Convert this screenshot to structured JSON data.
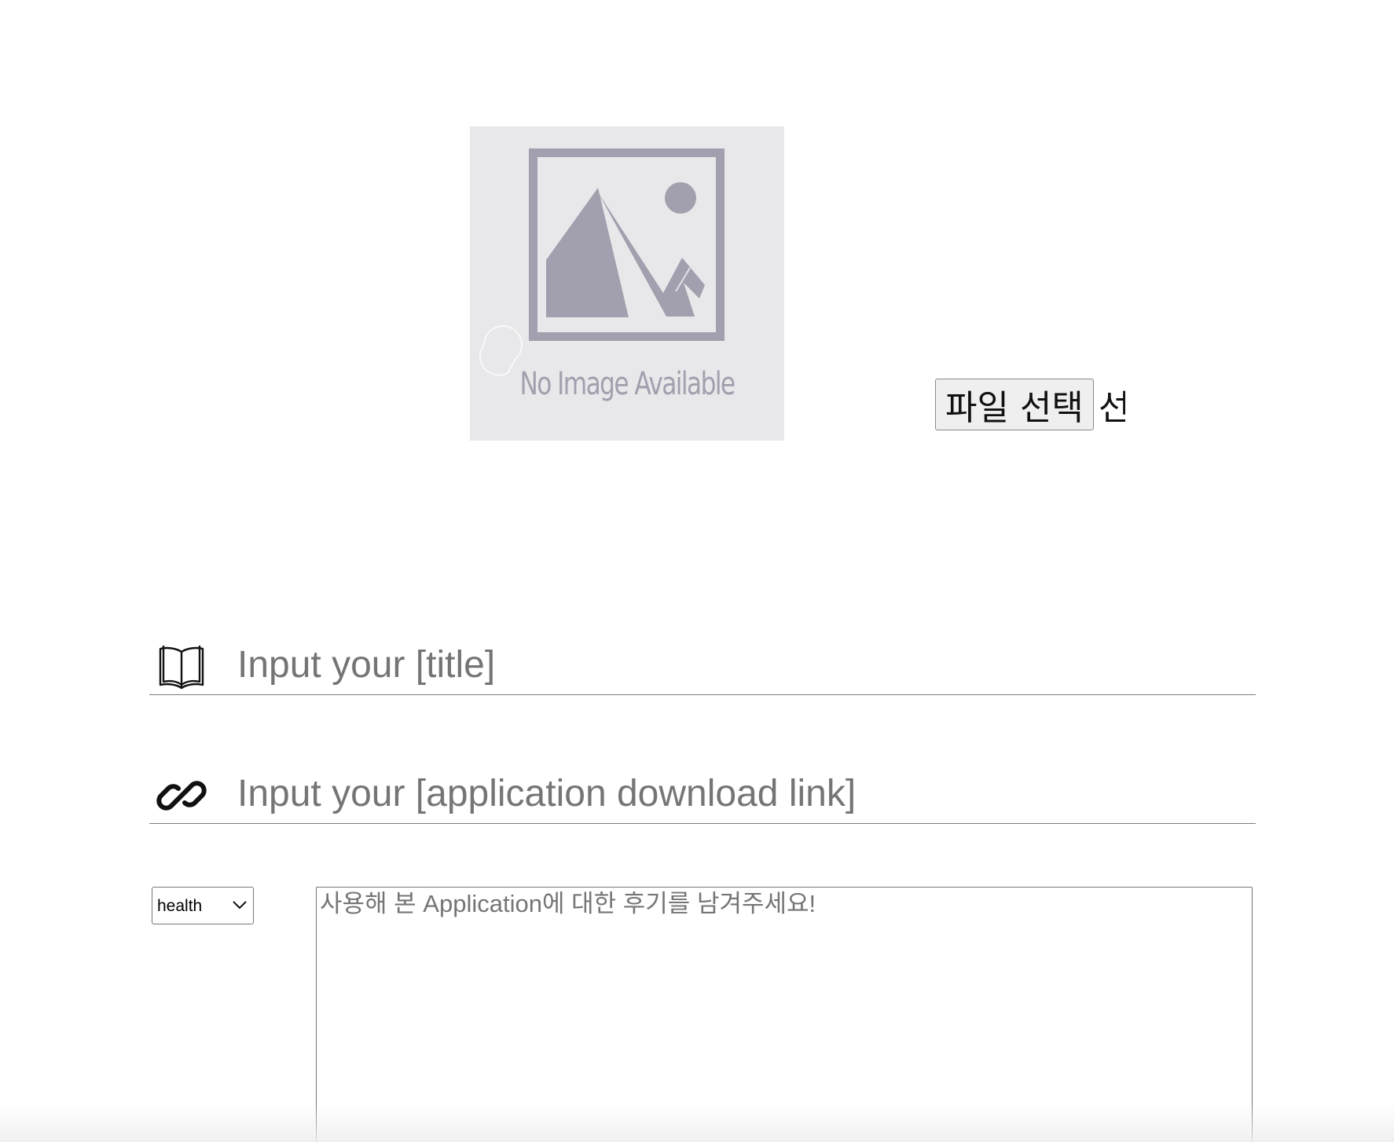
{
  "image_upload": {
    "placeholder_caption": "No Image Available",
    "file_button_label": "파일 선택",
    "file_status_text": "선",
    "icon": "image-placeholder-icon"
  },
  "form": {
    "title_field": {
      "icon": "book-icon",
      "placeholder": "Input your [title]",
      "value": ""
    },
    "link_field": {
      "icon": "link-icon",
      "placeholder": "Input your [application download link]",
      "value": ""
    },
    "category": {
      "selected": "health",
      "options": [
        "health"
      ]
    },
    "review": {
      "placeholder": "사용해 본 Application에 대한 후기를 남겨주세요!",
      "value": ""
    }
  },
  "colors": {
    "placeholder_bg": "#e8e8ea",
    "placeholder_art": "#a29fae",
    "underline": "#7d7d7d",
    "placeholder_text": "#757575"
  }
}
